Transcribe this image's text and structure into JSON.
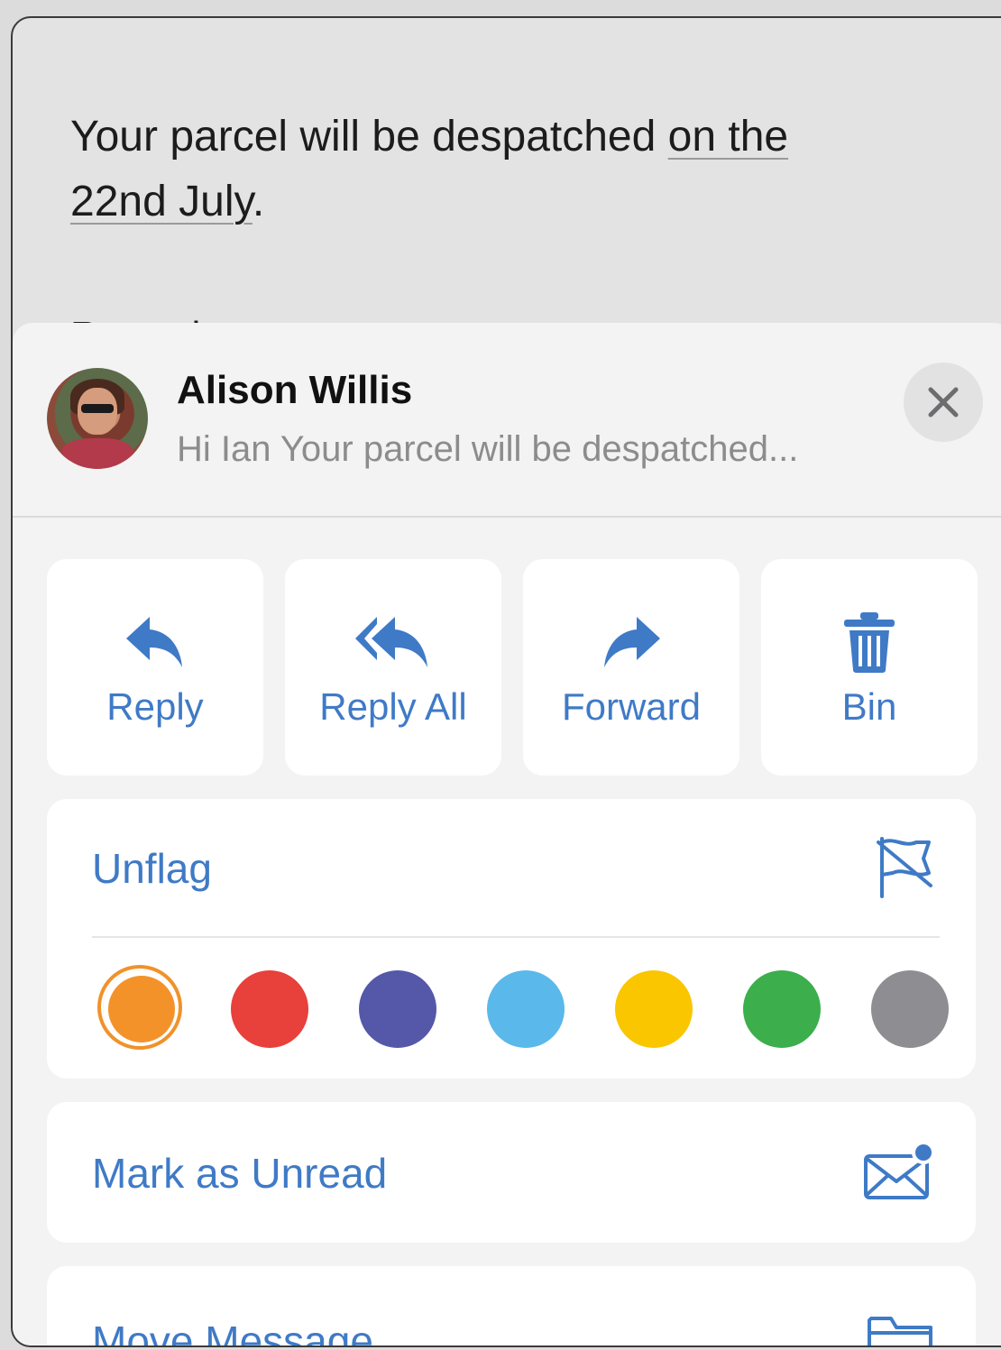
{
  "email": {
    "body_line1_prefix": "Your parcel will be despatched ",
    "body_line1_date": "on the",
    "body_line2_date": "22nd July",
    "body_line2_suffix": ".",
    "regards": "Regards"
  },
  "sheet": {
    "sender_name": "Alison Willis",
    "preview": "Hi Ian Your parcel will be despatched...",
    "avatar_icon": "contact-photo",
    "close_icon": "close-icon"
  },
  "actions": [
    {
      "label": "Reply",
      "icon": "reply-icon"
    },
    {
      "label": "Reply All",
      "icon": "reply-all-icon"
    },
    {
      "label": "Forward",
      "icon": "forward-icon"
    },
    {
      "label": "Bin",
      "icon": "bin-icon"
    }
  ],
  "flag_row": {
    "label": "Unflag",
    "icon": "unflag-icon",
    "colors": [
      {
        "name": "orange",
        "hex": "#f4922a",
        "selected": true
      },
      {
        "name": "red",
        "hex": "#e8403a",
        "selected": false
      },
      {
        "name": "purple",
        "hex": "#5558a8",
        "selected": false
      },
      {
        "name": "light-blue",
        "hex": "#5bb8ea",
        "selected": false
      },
      {
        "name": "yellow",
        "hex": "#f9c600",
        "selected": false
      },
      {
        "name": "green",
        "hex": "#3cae4c",
        "selected": false
      },
      {
        "name": "grey",
        "hex": "#8e8e92",
        "selected": false
      }
    ]
  },
  "unread_row": {
    "label": "Mark as Unread",
    "icon": "unread-envelope-icon"
  },
  "move_row": {
    "label": "Move Message",
    "icon": "folder-icon"
  },
  "accent": "#3f7ac6"
}
